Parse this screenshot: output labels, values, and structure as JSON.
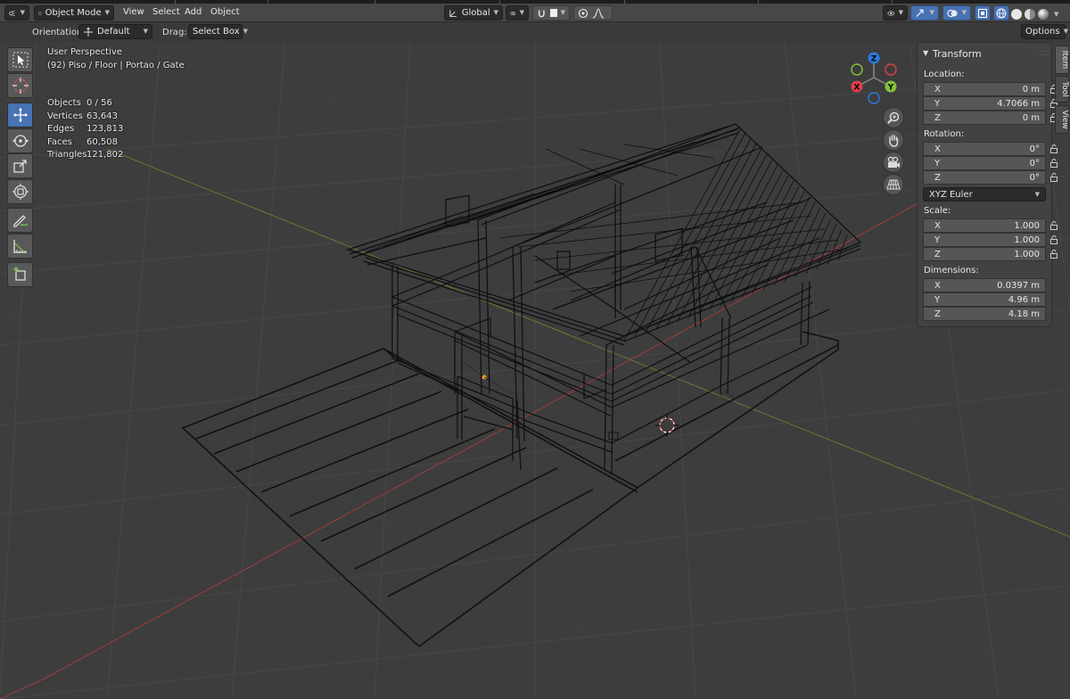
{
  "header": {
    "mode": "Object Mode",
    "menus": [
      "View",
      "Select",
      "Add",
      "Object"
    ],
    "transform_space": "Global"
  },
  "toolbar": {
    "orientation_label": "Orientation:",
    "orientation_value": "Default",
    "drag_label": "Drag:",
    "drag_value": "Select Box",
    "options": "Options"
  },
  "viewport": {
    "view_name": "User Perspective",
    "collection": "(92) Piso / Floor | Portao / Gate",
    "stats": [
      {
        "label": "Objects",
        "value": "0 / 56"
      },
      {
        "label": "Vertices",
        "value": "63,643"
      },
      {
        "label": "Edges",
        "value": "123,813"
      },
      {
        "label": "Faces",
        "value": "60,508"
      },
      {
        "label": "Triangles",
        "value": "121,802"
      }
    ],
    "gizmo": {
      "x": "X",
      "y": "Y",
      "z": "Z"
    }
  },
  "transform_panel": {
    "title": "Transform",
    "location_label": "Location:",
    "location": [
      {
        "axis": "X",
        "value": "0 m"
      },
      {
        "axis": "Y",
        "value": "4.7066 m"
      },
      {
        "axis": "Z",
        "value": "0 m"
      }
    ],
    "rotation_label": "Rotation:",
    "rotation": [
      {
        "axis": "X",
        "value": "0°"
      },
      {
        "axis": "Y",
        "value": "0°"
      },
      {
        "axis": "Z",
        "value": "0°"
      }
    ],
    "rotation_mode": "XYZ Euler",
    "scale_label": "Scale:",
    "scale": [
      {
        "axis": "X",
        "value": "1.000"
      },
      {
        "axis": "Y",
        "value": "1.000"
      },
      {
        "axis": "Z",
        "value": "1.000"
      }
    ],
    "dimensions_label": "Dimensions:",
    "dimensions": [
      {
        "axis": "X",
        "value": "0.0397 m"
      },
      {
        "axis": "Y",
        "value": "4.96 m"
      },
      {
        "axis": "Z",
        "value": "4.18 m"
      }
    ]
  },
  "sidetabs": [
    "Item",
    "Tool",
    "View"
  ],
  "colors": {
    "active_tool": "#4772b3",
    "x_axis": "#e0424c",
    "y_axis": "#8ac33d",
    "z_axis": "#3b8ce9"
  }
}
